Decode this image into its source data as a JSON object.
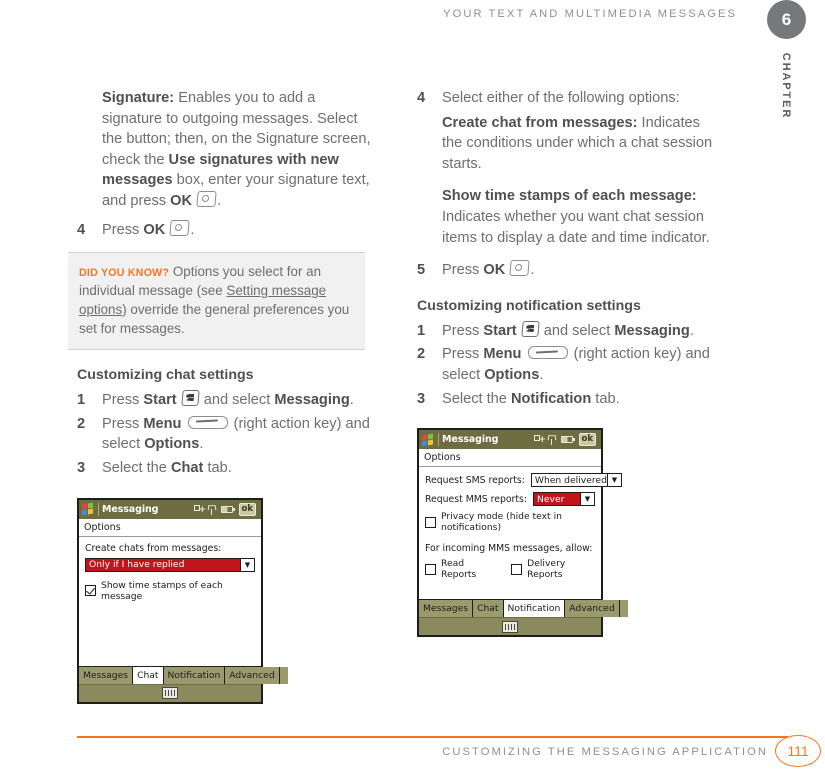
{
  "header": {
    "title": "Your Text and Multimedia Messages",
    "chapter_number": "6",
    "chapter_word": "CHAPTER"
  },
  "footer": {
    "title": "Customizing the Messaging Application",
    "page_number": "111",
    "accent_color": "#f47521"
  },
  "left_column": {
    "signature_term": "Signature:",
    "signature_text_1": " Enables you to add a signature to outgoing messages. Select the button; then, on the Signature screen, check the ",
    "signature_bold_2": "Use signatures with new messages",
    "signature_text_3": " box, enter your signature text, and press ",
    "signature_bold_4": "OK",
    "step4_num": "4",
    "step4_text_1": "Press ",
    "step4_bold": "OK",
    "tip": {
      "label": "Did you know?",
      "text_1": " Options you select for an individual message (see ",
      "link": "Setting message options",
      "text_2": ") override the general preferences you set for messages."
    },
    "chat_heading": "Customizing chat settings",
    "chat_steps": [
      {
        "num": "1",
        "t1": "Press ",
        "b1": "Start",
        "t2": " and select ",
        "b2": "Messaging",
        "t3": "."
      },
      {
        "num": "2",
        "t1": "Press ",
        "b1": "Menu",
        "t2": " (right action key) and select ",
        "b2": "Options",
        "t3": "."
      },
      {
        "num": "3",
        "t1": "Select the ",
        "b1": "Chat",
        "t2": " tab.",
        "b2": "",
        "t3": ""
      }
    ]
  },
  "right_column": {
    "step4_num": "4",
    "step4_text": "Select either of the following options:",
    "opt1_term": "Create chat from messages:",
    "opt1_text": " Indicates the conditions under which a chat session starts.",
    "opt2_term": "Show time stamps of each message:",
    "opt2_text": " Indicates whether you want chat session items to display a date and time indicator.",
    "step5_num": "5",
    "step5_text_1": "Press ",
    "step5_bold": "OK",
    "notif_heading": "Customizing notification settings",
    "notif_steps": [
      {
        "num": "1",
        "t1": "Press ",
        "b1": "Start",
        "t2": " and select ",
        "b2": "Messaging",
        "t3": "."
      },
      {
        "num": "2",
        "t1": "Press ",
        "b1": "Menu",
        "t2": " (right action key) and select ",
        "b2": "Options",
        "t3": "."
      },
      {
        "num": "3",
        "t1": "Select the ",
        "b1": "Notification",
        "t2": " tab.",
        "b2": "",
        "t3": ""
      }
    ]
  },
  "device_chat": {
    "title": "Messaging",
    "ok_button": "ok",
    "subtitle": "Options",
    "field_label": "Create chats from messages:",
    "dropdown_value": "Only if I have replied",
    "checkbox_label": "Show time stamps of each message",
    "checkbox_checked": true,
    "tabs": [
      "Messages",
      "Chat",
      "Notification",
      "Advanced"
    ],
    "selected_tab": "Chat",
    "highlight_color": "#c1151b",
    "titlebar_color": "#6d6d41"
  },
  "device_notification": {
    "title": "Messaging",
    "ok_button": "ok",
    "subtitle": "Options",
    "sms_label": "Request SMS reports:",
    "sms_value": "When delivered",
    "mms_label": "Request MMS reports:",
    "mms_value": "Never",
    "privacy_label": "Privacy mode (hide text in notifications)",
    "privacy_checked": false,
    "incoming_label": "For incoming MMS messages, allow:",
    "read_reports_label": "Read Reports",
    "read_reports_checked": false,
    "delivery_reports_label": "Delivery Reports",
    "delivery_reports_checked": false,
    "tabs": [
      "Messages",
      "Chat",
      "Notification",
      "Advanced"
    ],
    "selected_tab": "Notification",
    "highlight_color": "#c1151b",
    "titlebar_color": "#6d6d41"
  }
}
